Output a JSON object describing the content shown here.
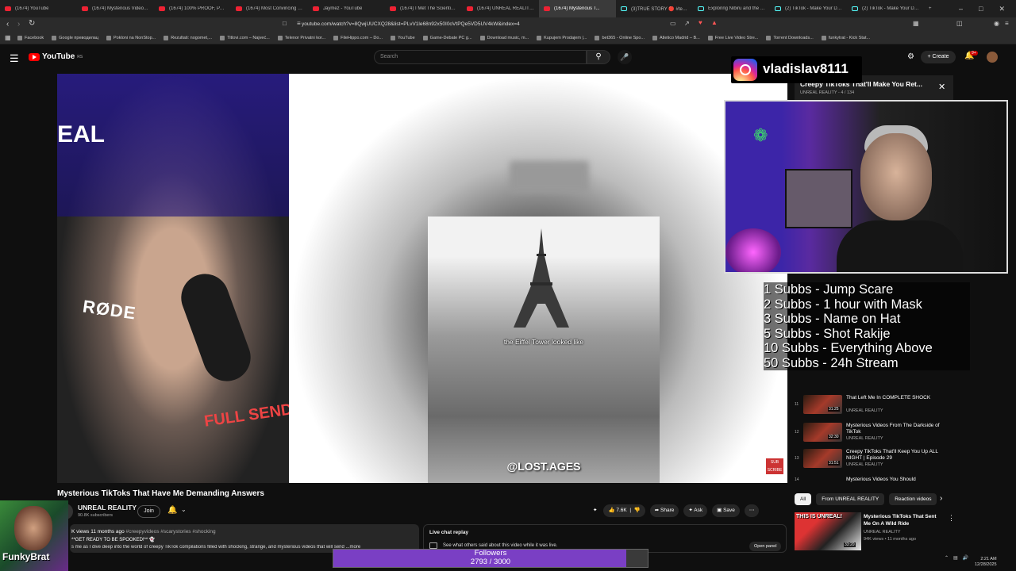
{
  "browser": {
    "tabs": [
      {
        "label": "(1674) YouTube",
        "icon": "youtube-favicon"
      },
      {
        "label": "(1674) Mysterious Videos F...",
        "icon": "youtube-favicon"
      },
      {
        "label": "(1674) 100% PROOF, PAR...",
        "icon": "youtube-favicon"
      },
      {
        "label": "(1674) Most Convincing Ev...",
        "icon": "youtube-favicon"
      },
      {
        "label": "Jaymez - YouTube",
        "icon": "youtube-favicon"
      },
      {
        "label": "(1674) I Met The Scientist T...",
        "icon": "youtube-favicon"
      },
      {
        "label": "(1674) UNREAL REALITY - Y...",
        "icon": "youtube-favicon"
      },
      {
        "label": "(1674) Mysterious T...",
        "icon": "youtube-favicon",
        "active": true
      },
      {
        "label": "(3)TRUE STORY 🔴 #terror...",
        "icon": "tiktok-favicon"
      },
      {
        "label": "Exploring Nibiru and the N...",
        "icon": "tiktok-favicon"
      },
      {
        "label": "(2) TikTok - Make Your Day",
        "icon": "tiktok-favicon"
      },
      {
        "label": "(2) TikTok - Make Your Day",
        "icon": "tiktok-favicon"
      }
    ],
    "window_controls": {
      "minimize": "–",
      "maximize": "□",
      "close": "✕"
    },
    "url": "youtube.com/watch?v=8QwjUUCXQ28&list=PLvV1le68n92x50I0oVtPQe5VD5UV4kW&index=4",
    "bookmarks": [
      "Facebook",
      "Google преводилац",
      "Pokloni na NonStop...",
      "Rezultati: nogomet,...",
      "Titlovi.com – Najveć...",
      "Telenor Privatni kor...",
      "FileHippo.com – Do...",
      "YouTube",
      "Game-Debate PC g...",
      "Download music, m...",
      "Kupujem Prodajem |...",
      "bet365 - Online Spo...",
      "Atletico Madrid – B...",
      "Free Live Video Stre...",
      "Torrent Downloads...",
      "funkytrat - Kick Stat..."
    ]
  },
  "youtube": {
    "logo_text": "YouTube",
    "logo_sup": "RS",
    "search_placeholder": "Search",
    "create_label": "Create",
    "notif_badge": "9+"
  },
  "video": {
    "caption": "the Eiffel Tower looked like",
    "watermark": "@LOST.AGES",
    "rode_label": "RØDE",
    "shirt_text": "FULL SEND",
    "background_text": "EAL",
    "sub_badge": "SUB SCRIBE"
  },
  "overlay": {
    "instagram_name": "vladislav8111",
    "sub_goals": [
      "1 Subbs - Jump Scare",
      "2 Subbs - 1 hour with Mask",
      "3 Subbs - Name on Hat",
      "5 Subbs - Shot Rakije",
      "10 Subbs - Everything Above",
      "50 Subbs - 24h Stream"
    ],
    "followers_label": "Followers",
    "followers_count": "2793 / 3000",
    "followers_current": 2793,
    "followers_goal": 3000,
    "funky_name": "FunkyBrat"
  },
  "playlist": {
    "title": "Creepy TikToks That'll Make You Ret...",
    "subtitle": "UNREAL REALITY - 4 / 134",
    "items": [
      {
        "num": "11",
        "duration": "31:25",
        "title": "That Left Me In COMPLETE SHOCK",
        "channel": "UNREAL REALITY"
      },
      {
        "num": "12",
        "duration": "32:30",
        "title": "Mysterious Videos From The Darkside of TikTok",
        "channel": "UNREAL REALITY"
      },
      {
        "num": "13",
        "duration": "31:51",
        "title": "Creepy TikToks That'll Keep You Up ALL NIGHT | Episode 29",
        "channel": "UNREAL REALITY"
      },
      {
        "num": "14",
        "duration": "",
        "title": "Mysterious Videos You Should",
        "channel": ""
      }
    ]
  },
  "chips": [
    "All",
    "From UNREAL REALITY",
    "Reaction videos"
  ],
  "recommended": {
    "thumb_text": "THIS IS UNREAL!",
    "duration": "33:20",
    "title": "Mysterious TikToks That Sent Me On A Wild Ride",
    "channel": "UNREAL REALITY",
    "meta": "94K views • 11 months ago"
  },
  "watch": {
    "title": "Mysterious TikToks That Have Me Demanding Answers",
    "channel": "UNREAL REALITY",
    "subs": "90.8K subscribers",
    "join": "Join",
    "likes": "7.6K",
    "share": "Share",
    "ask": "Ask",
    "save": "Save",
    "desc_views": "K views  11 months ago",
    "desc_tags": "#creepyvideos #scarystories #shocking",
    "desc_line1": "**GET READY TO BE SPOOKED!** 👻",
    "desc_line2": "s me as I dive deep into the world of creepy TikTok compilations filled with shocking, strange, and mysterious videos that will send ...more",
    "livechat_title": "Live chat replay",
    "livechat_desc": "See what others said about this video while it was live.",
    "open_panel": "Open panel"
  },
  "system": {
    "time": "2:21 AM",
    "date": "12/28/2025"
  }
}
